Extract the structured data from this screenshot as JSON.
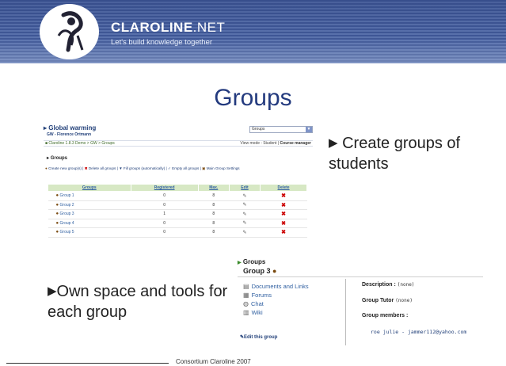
{
  "banner": {
    "brand": "CLAROLINE",
    "brand_suffix": ".NET",
    "tagline": "Let's build knowledge together",
    "bg_color": "#4a63a2"
  },
  "slide_title": "Groups",
  "course": {
    "title": "Global warming",
    "subtitle": "GW - Florence Ortmann",
    "breadcrumb": "Claroline 1.8.3 Demo > GW > Groups",
    "view_mode_label": "View mode :",
    "view_mode_value": "Student",
    "view_mode_sep": "|",
    "course_manager": "Course manager",
    "tool_select": "Groups"
  },
  "groups_section": {
    "title": "Groups",
    "tools": [
      {
        "icon": "group-icon",
        "label": "Create new group(s)"
      },
      {
        "icon": "delete-icon",
        "label": "Delete all groups"
      },
      {
        "icon": "fill-icon",
        "label": "Fill groups (automatically)"
      },
      {
        "icon": "empty-icon",
        "label": "Empty all groups"
      },
      {
        "icon": "settings-icon",
        "label": "Main Group Settings"
      }
    ],
    "columns": [
      "Groups",
      "Registered",
      "Max.",
      "Edit",
      "Delete"
    ],
    "rows": [
      {
        "name": "Group 1",
        "registered": "0",
        "max": "8"
      },
      {
        "name": "Group 2",
        "registered": "0",
        "max": "8"
      },
      {
        "name": "Group 3",
        "registered": "1",
        "max": "8"
      },
      {
        "name": "Group 4",
        "registered": "0",
        "max": "8"
      },
      {
        "name": "Group 5",
        "registered": "0",
        "max": "8"
      }
    ]
  },
  "bullet1": "Create groups of students",
  "bullet2": "Own space and tools for each group",
  "group_space": {
    "breadcrumb": "Groups",
    "title": "Group 3",
    "tools": [
      {
        "icon": "documents-icon",
        "label": "Documents and Links"
      },
      {
        "icon": "forums-icon",
        "label": "Forums"
      },
      {
        "icon": "chat-icon",
        "label": "Chat"
      },
      {
        "icon": "wiki-icon",
        "label": "Wiki"
      }
    ],
    "edit_label": "Edit this group",
    "description_label": "Description :",
    "description_value": "(none)",
    "tutor_label": "Group Tutor",
    "tutor_value": "(none)",
    "members_label": "Group members :",
    "member": "roe julie - jammer112@yahoo.com"
  },
  "footer": "Consortium Claroline 2007"
}
